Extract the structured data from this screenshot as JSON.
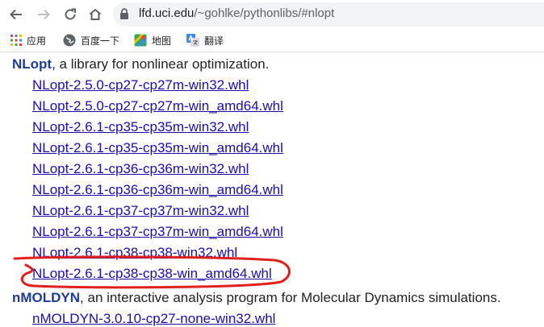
{
  "browser": {
    "url_prefix": "lfd.uci.edu",
    "url_rest": "/~gohlke/pythonlibs/#nlopt",
    "icons": {
      "back": "back-arrow-icon",
      "forward": "forward-arrow-icon",
      "reload": "reload-icon",
      "home": "home-icon",
      "security": "lock-icon"
    }
  },
  "bookmarks": [
    {
      "label": "应用",
      "icon": "apps-grid-icon"
    },
    {
      "label": "百度一下",
      "icon": "globe-icon"
    },
    {
      "label": "地图",
      "icon": "maps-icon"
    },
    {
      "label": "翻译",
      "icon": "translate-icon"
    }
  ],
  "sections": {
    "nlopt": {
      "name": "NLopt",
      "desc": ", a library for nonlinear optimization."
    },
    "nmoldyn": {
      "name": "nMOLDYN",
      "desc": ", an interactive analysis program for Molecular Dynamics simulations."
    }
  },
  "nlopt_files": [
    "NLopt-2.5.0-cp27-cp27m-win32.whl",
    "NLopt-2.5.0-cp27-cp27m-win_amd64.whl",
    "NLopt-2.6.1-cp35-cp35m-win32.whl",
    "NLopt-2.6.1-cp35-cp35m-win_amd64.whl",
    "NLopt-2.6.1-cp36-cp36m-win32.whl",
    "NLopt-2.6.1-cp36-cp36m-win_amd64.whl",
    "NLopt-2.6.1-cp37-cp37m-win32.whl",
    "NLopt-2.6.1-cp37-cp37m-win_amd64.whl",
    "NLopt-2.6.1-cp38-cp38-win32.whl",
    "NLopt-2.6.1-cp38-cp38-win_amd64.whl"
  ],
  "nmoldyn_files": [
    "nMOLDYN-3.0.10-cp27-none-win32.whl"
  ],
  "annotation_color": "#e0201b"
}
